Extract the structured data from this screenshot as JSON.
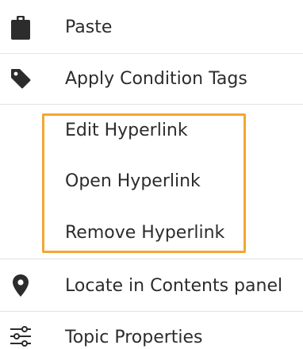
{
  "menu": {
    "items": [
      {
        "id": "paste",
        "label": "Paste",
        "icon": "clipboard-icon"
      },
      {
        "id": "apply-condition-tags",
        "label": "Apply Condition Tags",
        "icon": "tag-icon"
      },
      {
        "id": "edit-hyperlink",
        "label": "Edit Hyperlink",
        "icon": ""
      },
      {
        "id": "open-hyperlink",
        "label": "Open Hyperlink",
        "icon": ""
      },
      {
        "id": "remove-hyperlink",
        "label": "Remove Hyperlink",
        "icon": ""
      },
      {
        "id": "locate-in-contents-panel",
        "label": "Locate in Contents panel",
        "icon": "location-pin-icon"
      },
      {
        "id": "topic-properties",
        "label": "Topic Properties",
        "icon": "sliders-icon"
      }
    ]
  },
  "colors": {
    "text": "#2c2c2c",
    "icon": "#2c2c2c",
    "divider": "#e3e3e3",
    "highlight": "#f3a633"
  }
}
